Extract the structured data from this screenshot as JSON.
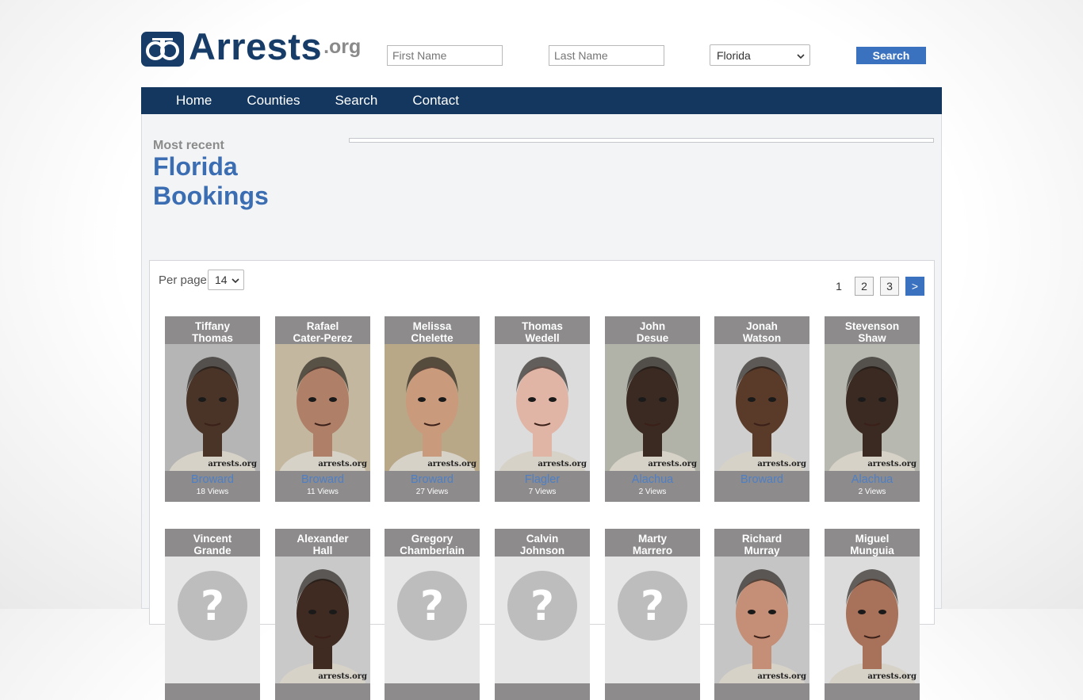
{
  "site": {
    "logo_text": "Arrests",
    "logo_suffix": ".org"
  },
  "search": {
    "first_name_placeholder": "First Name",
    "last_name_placeholder": "Last Name",
    "state_value": "Florida",
    "button_label": "Search"
  },
  "nav": {
    "items": [
      {
        "label": "Home"
      },
      {
        "label": "Counties"
      },
      {
        "label": "Search"
      },
      {
        "label": "Contact"
      }
    ]
  },
  "main": {
    "subtitle": "Most recent",
    "title_line1": "Florida",
    "title_line2": "Bookings"
  },
  "listing": {
    "per_page_label": "Per page",
    "per_page_value": "14",
    "pages": [
      "1",
      "2",
      "3",
      ">"
    ]
  },
  "watermark": "arrests.org",
  "cards": [
    {
      "first": "Tiffany",
      "last": "Thomas",
      "county": "Broward",
      "views": "18 Views",
      "photo": "mugshot",
      "skin": "#4a3428",
      "bg": "#b5b5b5"
    },
    {
      "first": "Rafael",
      "last": "Cater-Perez",
      "county": "Broward",
      "views": "11 Views",
      "photo": "mugshot",
      "skin": "#b07f68",
      "bg": "#c3b79f"
    },
    {
      "first": "Melissa",
      "last": "Chelette",
      "county": "Broward",
      "views": "27 Views",
      "photo": "mugshot",
      "skin": "#c99a7c",
      "bg": "#b9a888"
    },
    {
      "first": "Thomas",
      "last": "Wedell",
      "county": "Flagler",
      "views": "7 Views",
      "photo": "mugshot",
      "skin": "#e1b5a6",
      "bg": "#dcdcdc"
    },
    {
      "first": "John",
      "last": "Desue",
      "county": "Alachua",
      "views": "2 Views",
      "photo": "mugshot",
      "skin": "#3a2a22",
      "bg": "#b1b3a8"
    },
    {
      "first": "Jonah",
      "last": "Watson",
      "county": "Broward",
      "views": "",
      "photo": "mugshot",
      "skin": "#5a3a28",
      "bg": "#cfcfcf"
    },
    {
      "first": "Stevenson",
      "last": "Shaw",
      "county": "Alachua",
      "views": "2 Views",
      "photo": "mugshot",
      "skin": "#3b2a22",
      "bg": "#b7b8b0"
    },
    {
      "first": "Vincent",
      "last": "Grande",
      "county": "",
      "views": "",
      "photo": "placeholder",
      "skin": "",
      "bg": "#e6e6e6"
    },
    {
      "first": "Alexander",
      "last": "Hall",
      "county": "",
      "views": "",
      "photo": "mugshot",
      "skin": "#3f2b22",
      "bg": "#c9c9c9"
    },
    {
      "first": "Gregory",
      "last": "Chamberlain",
      "county": "",
      "views": "",
      "photo": "placeholder",
      "skin": "",
      "bg": "#e6e6e6"
    },
    {
      "first": "Calvin",
      "last": "Johnson",
      "county": "",
      "views": "",
      "photo": "placeholder",
      "skin": "",
      "bg": "#e6e6e6"
    },
    {
      "first": "Marty",
      "last": "Marrero",
      "county": "",
      "views": "",
      "photo": "placeholder",
      "skin": "",
      "bg": "#e6e6e6"
    },
    {
      "first": "Richard",
      "last": "Murray",
      "county": "",
      "views": "",
      "photo": "mugshot",
      "skin": "#c48f76",
      "bg": "#c5c5c5"
    },
    {
      "first": "Miguel",
      "last": "Munguia",
      "county": "",
      "views": "",
      "photo": "mugshot",
      "skin": "#a8725a",
      "bg": "#dcdcdc"
    }
  ]
}
